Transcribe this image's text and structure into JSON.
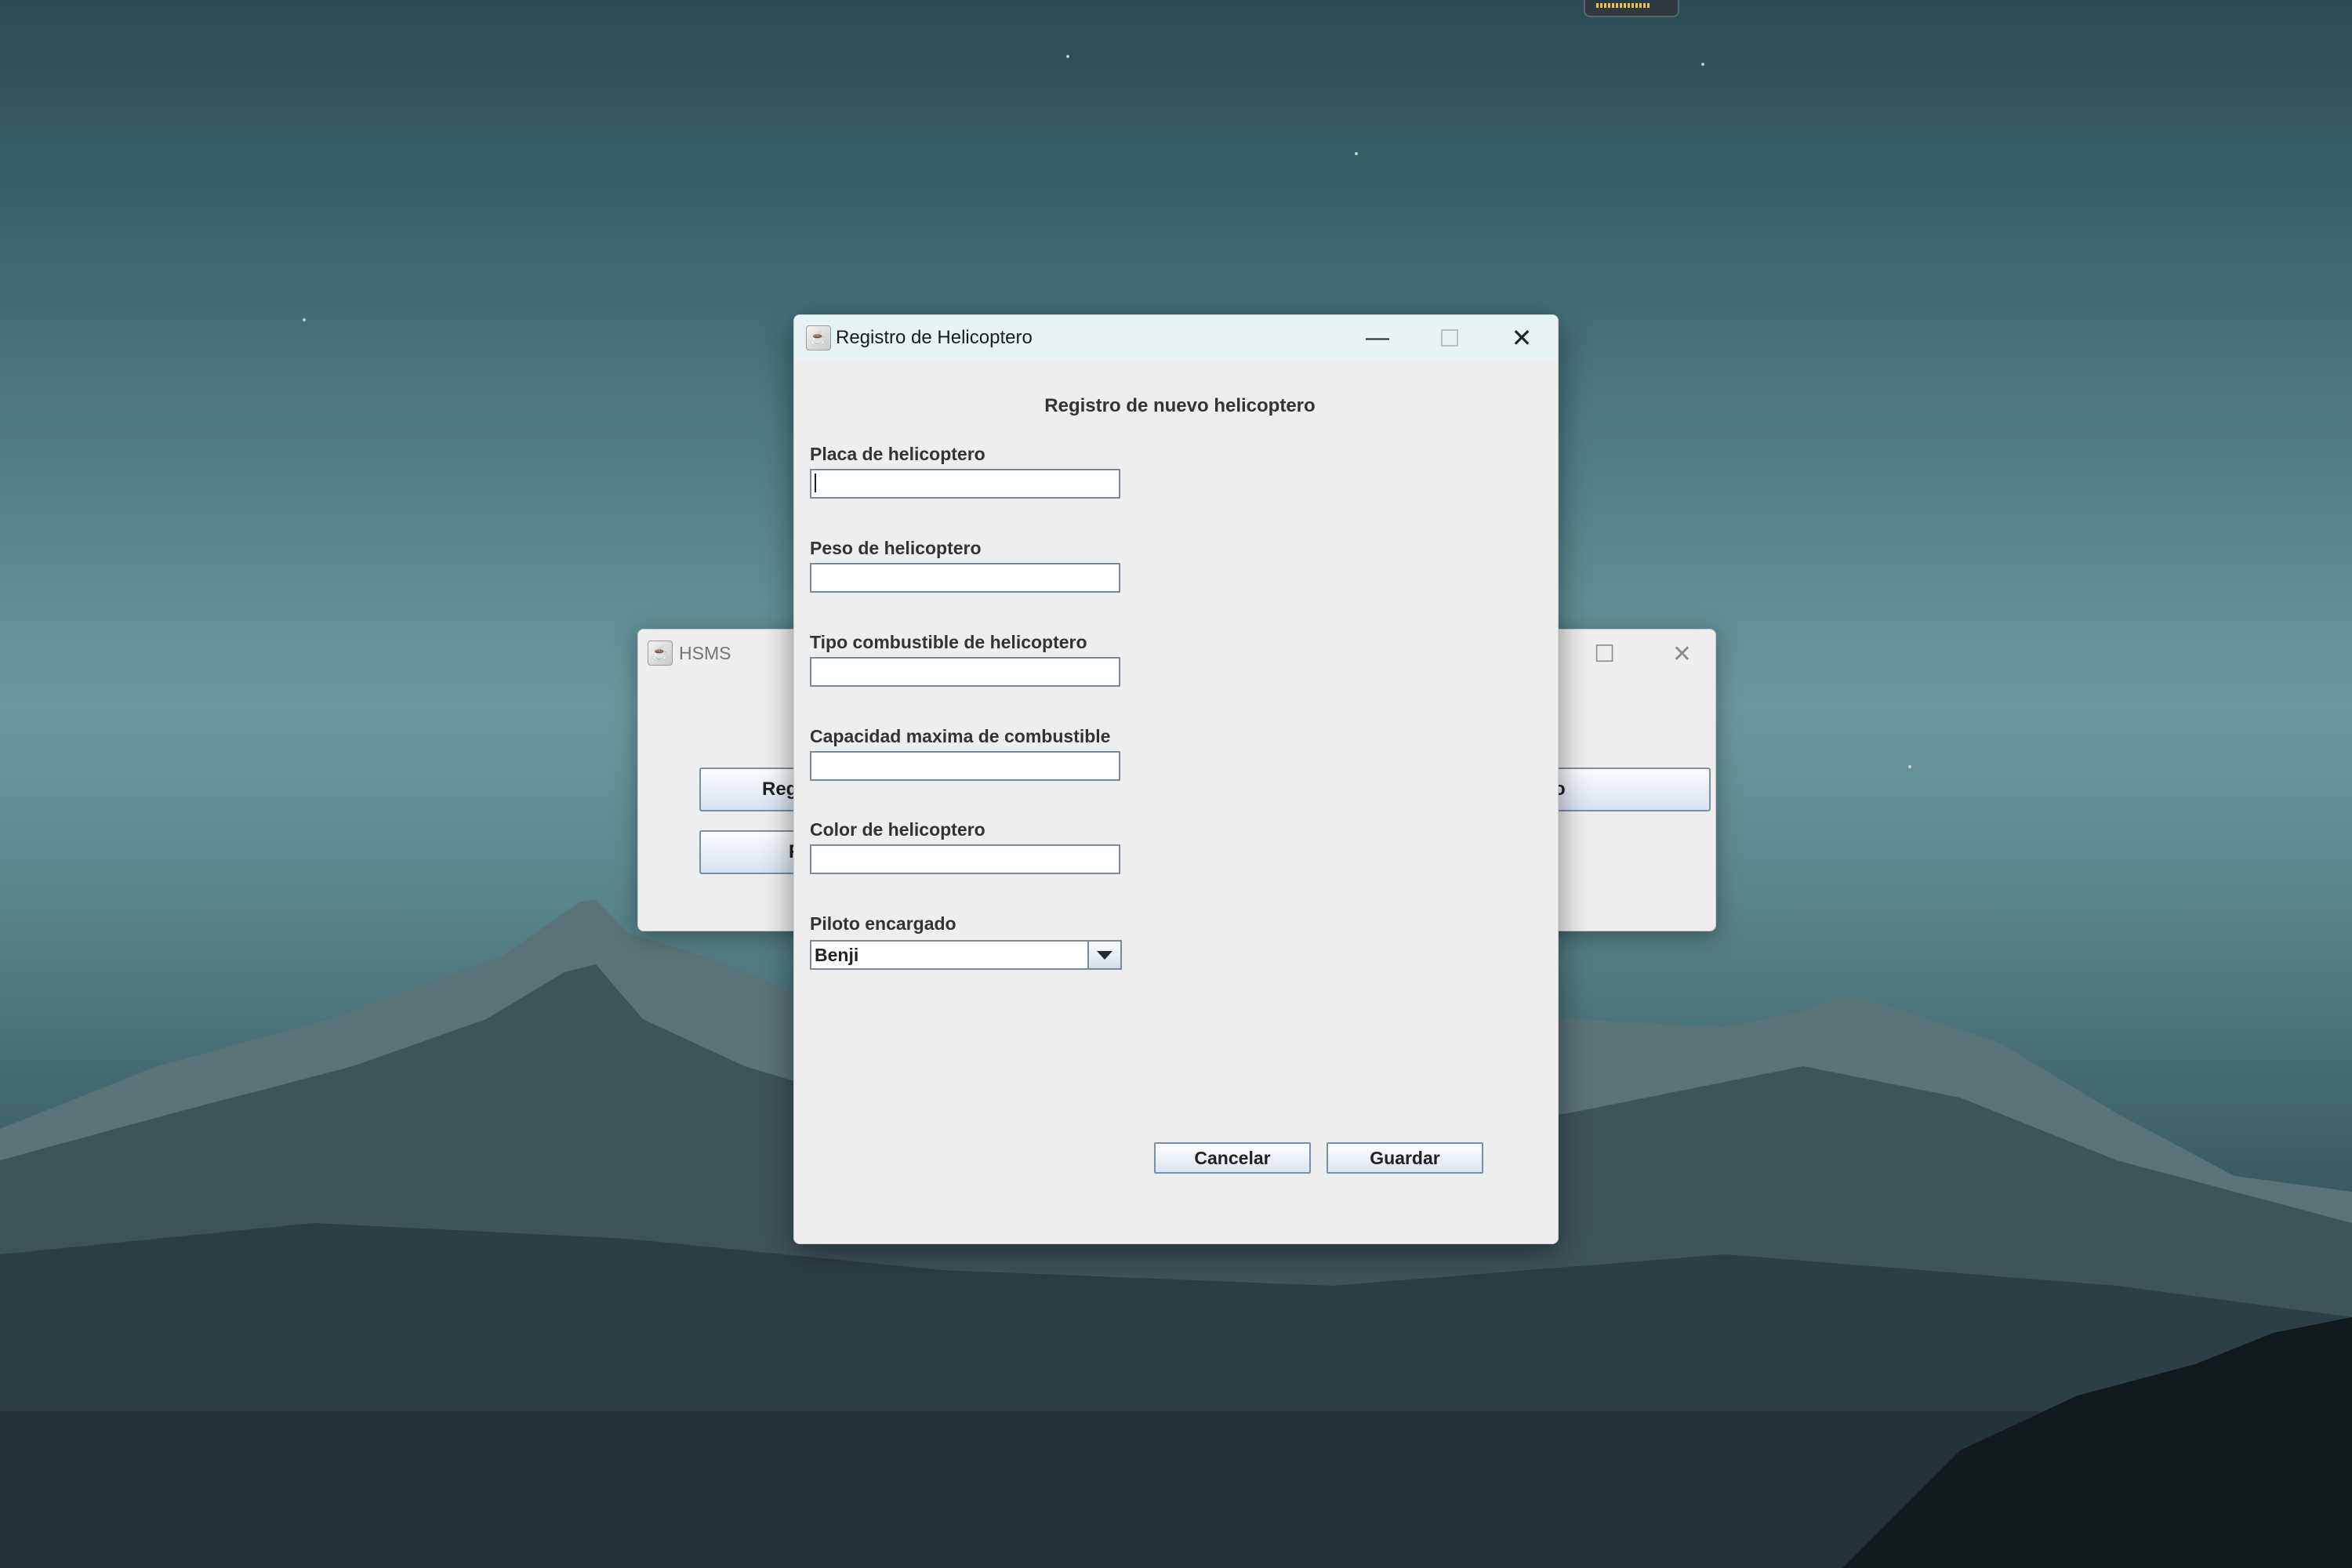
{
  "background_window": {
    "title": "HSMS",
    "button_left_top_fragment": "Reg",
    "button_left_bottom_fragment": "R",
    "button_right_top_fragment": "o",
    "controls": {
      "maximize": "☐",
      "close": "✕"
    }
  },
  "dialog": {
    "title": "Registro de Helicoptero",
    "controls": {
      "minimize": "—",
      "close": "✕"
    },
    "heading": "Registro de nuevo helicoptero",
    "fields": [
      {
        "label": "Placa de helicoptero",
        "value": ""
      },
      {
        "label": "Peso de helicoptero",
        "value": ""
      },
      {
        "label": "Tipo combustible de helicoptero",
        "value": ""
      },
      {
        "label": "Capacidad maxima de combustible",
        "value": ""
      },
      {
        "label": "Color de helicoptero",
        "value": ""
      }
    ],
    "pilot": {
      "label": "Piloto encargado",
      "selected": "Benji"
    },
    "buttons": {
      "cancel": "Cancelar",
      "save": "Guardar"
    }
  },
  "icons": [
    "java-icon",
    "minimize-icon",
    "maximize-icon",
    "close-icon",
    "dropdown-arrow-icon"
  ]
}
